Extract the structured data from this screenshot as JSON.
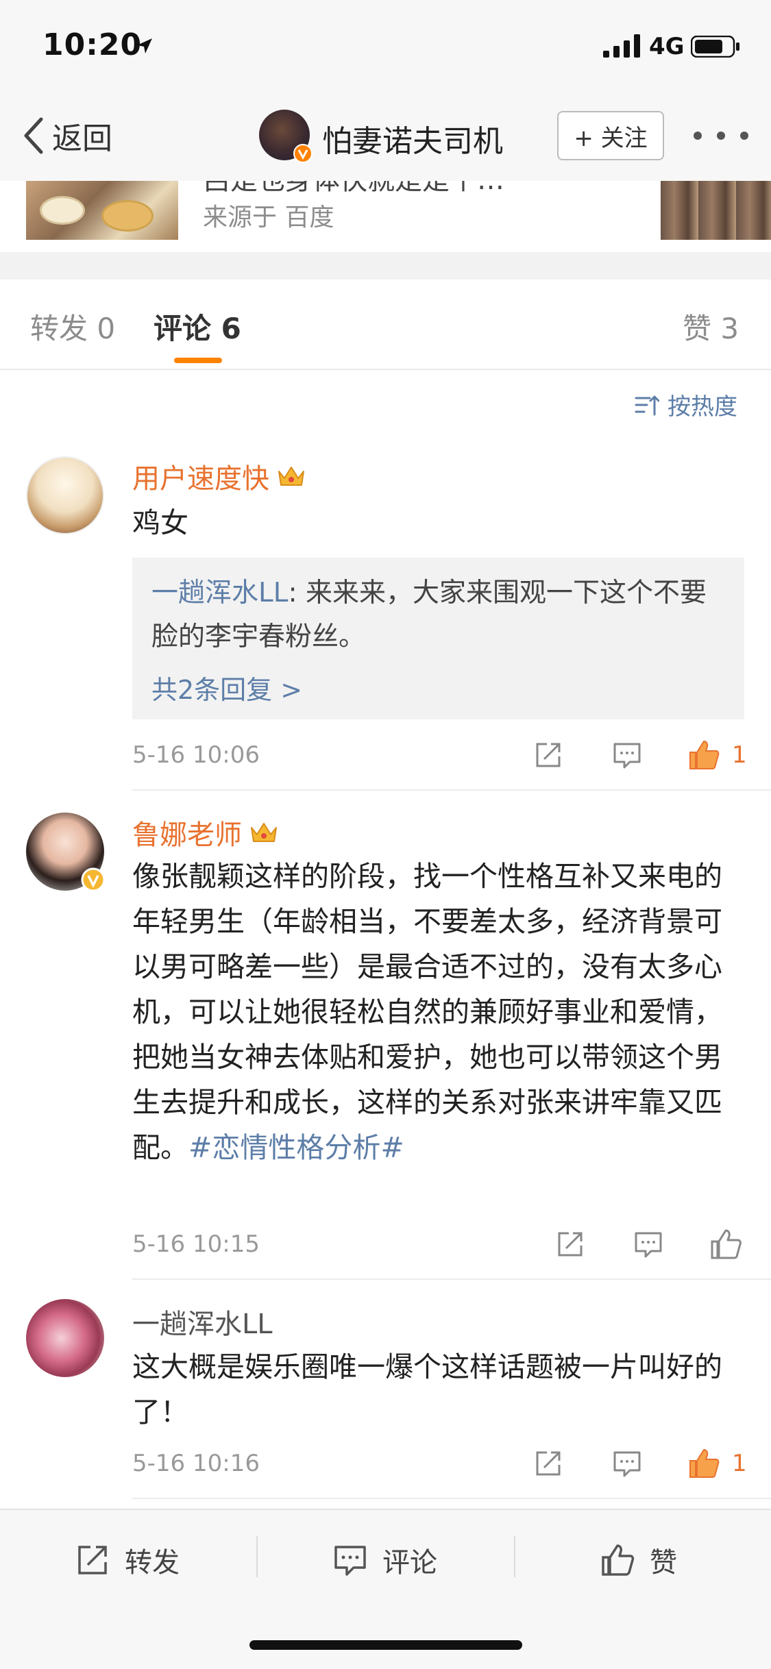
{
  "status_bar": {
    "time": "10:20",
    "network": "4G"
  },
  "nav": {
    "back_label": "返回",
    "title": "怕妻诺夫司机",
    "follow_label": "+ 关注"
  },
  "card": {
    "title_fragment": "吕是也身体快就是是个…",
    "source": "来源于 百度"
  },
  "tabs": {
    "repost": "转发 0",
    "comments": "评论 6",
    "likes": "赞 3"
  },
  "sort_label": "按热度",
  "comments": [
    {
      "username": "用户速度快",
      "text": "鸡女",
      "reply_user": "一趟浑水LL",
      "reply_text": ": 来来来，大家来围观一下这个不要脸的李宇春粉丝。",
      "reply_more": "共2条回复 >",
      "time": "5-16 10:06",
      "likes": "1"
    },
    {
      "username": "鲁娜老师",
      "text": "像张靓颖这样的阶段，找一个性格互补又来电的年轻男生（年龄相当，不要差太多，经济背景可以男可略差一些）是最合适不过的，没有太多心机，可以让她很轻松自然的兼顾好事业和爱情，把她当女神去体贴和爱护，她也可以带领这个男生去提升和成长，这样的关系对张来讲牢靠又匹配。",
      "topic": "#恋情性格分析#",
      "time": "5-16 10:15"
    },
    {
      "username": "一趟浑水LL",
      "text": "这大概是娱乐圈唯一爆个这样话题被一片叫好的了！",
      "time": "5-16 10:16",
      "likes": "1"
    }
  ],
  "toolbar": {
    "repost": "转发",
    "comment": "评论",
    "like": "赞"
  },
  "colors": {
    "accent_orange": "#ff8200",
    "link_blue": "#5d7ea8",
    "username_orange": "#e8722f"
  },
  "icons": [
    "location-arrow-icon",
    "signal-icon",
    "battery-icon",
    "back-chevron-icon",
    "verified-badge-icon",
    "crown-icon",
    "share-icon",
    "comment-icon",
    "thumbs-up-icon",
    "sort-icon"
  ]
}
